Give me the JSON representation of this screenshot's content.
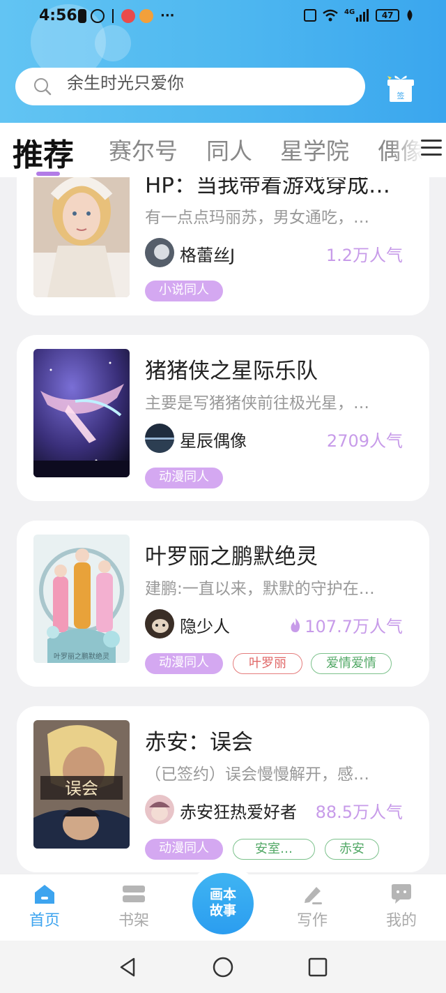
{
  "status_bar": {
    "time": "4:56",
    "dots": "···",
    "net": "4G",
    "battery": "47"
  },
  "search": {
    "placeholder": "余生时光只爱你"
  },
  "gift": {
    "label": "签"
  },
  "tabs": [
    "推荐",
    "赛尔号",
    "同人",
    "星学院",
    "偶像"
  ],
  "active_tab": 0,
  "cards": [
    {
      "title": "HP：当我带着游戏穿成…",
      "desc": "有一点点玛丽苏，男女通吃，…",
      "author": "格蕾丝J",
      "popularity": "1.2万人气",
      "hot": false,
      "tags": [
        {
          "label": "小说同人",
          "style": "purple"
        }
      ]
    },
    {
      "title": "猪猪侠之星际乐队",
      "desc": "主要是写猪猪侠前往极光星，…",
      "author": "星辰偶像",
      "popularity": "2709人气",
      "hot": false,
      "tags": [
        {
          "label": "动漫同人",
          "style": "purple"
        }
      ]
    },
    {
      "title": "叶罗丽之鹏默绝灵",
      "desc": "建鹏:一直以来，默默的守护在…",
      "author": "隐少人",
      "popularity": "107.7万人气",
      "hot": true,
      "tags": [
        {
          "label": "动漫同人",
          "style": "purple"
        },
        {
          "label": "叶罗丽",
          "style": "red"
        },
        {
          "label": "爱情爱情",
          "style": "green"
        }
      ]
    },
    {
      "title": "赤安：误会",
      "desc": "（已签约）误会慢慢解开，感…",
      "author": "赤安狂热爱好者",
      "popularity": "88.5万人气",
      "hot": false,
      "tags": [
        {
          "label": "动漫同人",
          "style": "purple"
        },
        {
          "label": "安室…",
          "style": "green"
        },
        {
          "label": "赤安",
          "style": "green"
        }
      ]
    }
  ],
  "bottom_nav": {
    "home": "首页",
    "shelf": "书架",
    "center_line1": "画本",
    "center_line2": "故事",
    "write": "写作",
    "me": "我的"
  },
  "colors": {
    "accent": "#3da4ef",
    "tag_purple": "#d4a8f1",
    "popularity": "#c79be9"
  }
}
